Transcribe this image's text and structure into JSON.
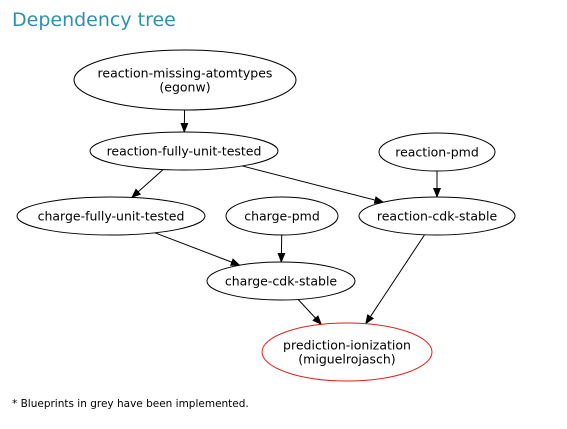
{
  "title": "Dependency tree",
  "footnote": "* Blueprints in grey have been implemented.",
  "colors": {
    "title": "#2e8fb0",
    "default_outline": "#000000",
    "highlight_outline": "#e0201b"
  },
  "nodes": [
    {
      "id": "reaction-missing-atomtypes",
      "lines": [
        "reaction-missing-atomtypes",
        "(egonw)"
      ],
      "highlight": false
    },
    {
      "id": "reaction-fully-unit-tested",
      "lines": [
        "reaction-fully-unit-tested"
      ],
      "highlight": false
    },
    {
      "id": "reaction-pmd",
      "lines": [
        "reaction-pmd"
      ],
      "highlight": false
    },
    {
      "id": "charge-fully-unit-tested",
      "lines": [
        "charge-fully-unit-tested"
      ],
      "highlight": false
    },
    {
      "id": "charge-pmd",
      "lines": [
        "charge-pmd"
      ],
      "highlight": false
    },
    {
      "id": "reaction-cdk-stable",
      "lines": [
        "reaction-cdk-stable"
      ],
      "highlight": false
    },
    {
      "id": "charge-cdk-stable",
      "lines": [
        "charge-cdk-stable"
      ],
      "highlight": false
    },
    {
      "id": "prediction-ionization",
      "lines": [
        "prediction-ionization",
        "(miguelrojasch)"
      ],
      "highlight": true
    }
  ],
  "edges": [
    {
      "from": "reaction-missing-atomtypes",
      "to": "reaction-fully-unit-tested"
    },
    {
      "from": "reaction-fully-unit-tested",
      "to": "charge-fully-unit-tested"
    },
    {
      "from": "reaction-fully-unit-tested",
      "to": "reaction-cdk-stable"
    },
    {
      "from": "reaction-pmd",
      "to": "reaction-cdk-stable"
    },
    {
      "from": "charge-fully-unit-tested",
      "to": "charge-cdk-stable"
    },
    {
      "from": "charge-pmd",
      "to": "charge-cdk-stable"
    },
    {
      "from": "charge-cdk-stable",
      "to": "prediction-ionization"
    },
    {
      "from": "reaction-cdk-stable",
      "to": "prediction-ionization"
    }
  ]
}
